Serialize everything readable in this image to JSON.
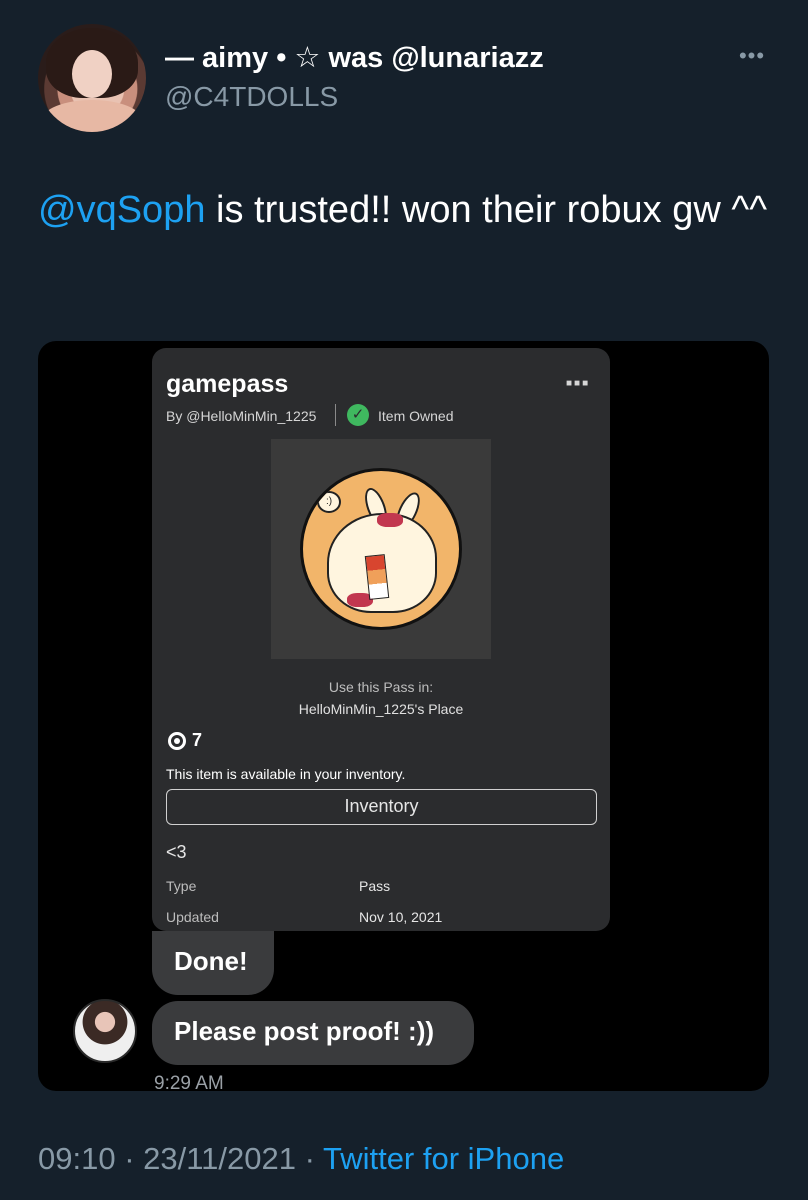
{
  "author": {
    "display_name": "— aimy • ☆ was @lunariazz",
    "handle": "@C4TDOLLS"
  },
  "tweet": {
    "mention": "@vqSoph",
    "text": " is trusted!! won their robux gw ^^"
  },
  "media": {
    "card": {
      "title": "gamepass",
      "by": "By @HelloMinMin_1225",
      "owned": "Item Owned",
      "use_pass": "Use this Pass in:",
      "place": "HelloMinMin_1225's Place",
      "price": "7",
      "available": "This item is available in your inventory.",
      "inventory_button": "Inventory",
      "description": "<3",
      "type_label": "Type",
      "type_value": "Pass",
      "updated_label": "Updated",
      "updated_value": "Nov 10, 2021"
    },
    "chat": {
      "message_1": "Done!",
      "message_2": "Please post proof! :))",
      "time": "9:29 AM"
    }
  },
  "footer": {
    "timestamp": "09:10 · 23/11/2021 · ",
    "source": "Twitter for iPhone"
  },
  "colors": {
    "background": "#15202b",
    "accent": "#1da1f2",
    "secondary_text": "#8899a6",
    "owned_check": "#3fb85f"
  },
  "icons": [
    "more-icon",
    "check-icon",
    "robux-icon",
    "avatar"
  ]
}
